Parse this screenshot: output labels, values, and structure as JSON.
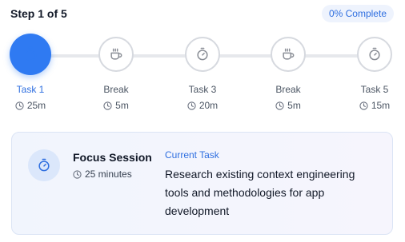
{
  "header": {
    "step_text": "Step 1 of 5",
    "progress_text": "0% Complete"
  },
  "colors": {
    "accent": "#2f7af2",
    "track": "#e6e8ec",
    "card_bg": "#f1f5fd"
  },
  "steps": [
    {
      "label": "Task 1",
      "duration": "25m",
      "icon": "timer-icon",
      "status": "active"
    },
    {
      "label": "Break",
      "duration": "5m",
      "icon": "coffee-icon",
      "status": "pending"
    },
    {
      "label": "Task 3",
      "duration": "20m",
      "icon": "timer-icon",
      "status": "pending"
    },
    {
      "label": "Break",
      "duration": "5m",
      "icon": "coffee-icon",
      "status": "pending"
    },
    {
      "label": "Task 5",
      "duration": "15m",
      "icon": "timer-icon",
      "status": "pending"
    }
  ],
  "session": {
    "title": "Focus Session",
    "duration": "25 minutes",
    "current_label": "Current Task",
    "description": "Research existing context engineering tools and methodologies for app development",
    "icon": "timer-icon"
  }
}
